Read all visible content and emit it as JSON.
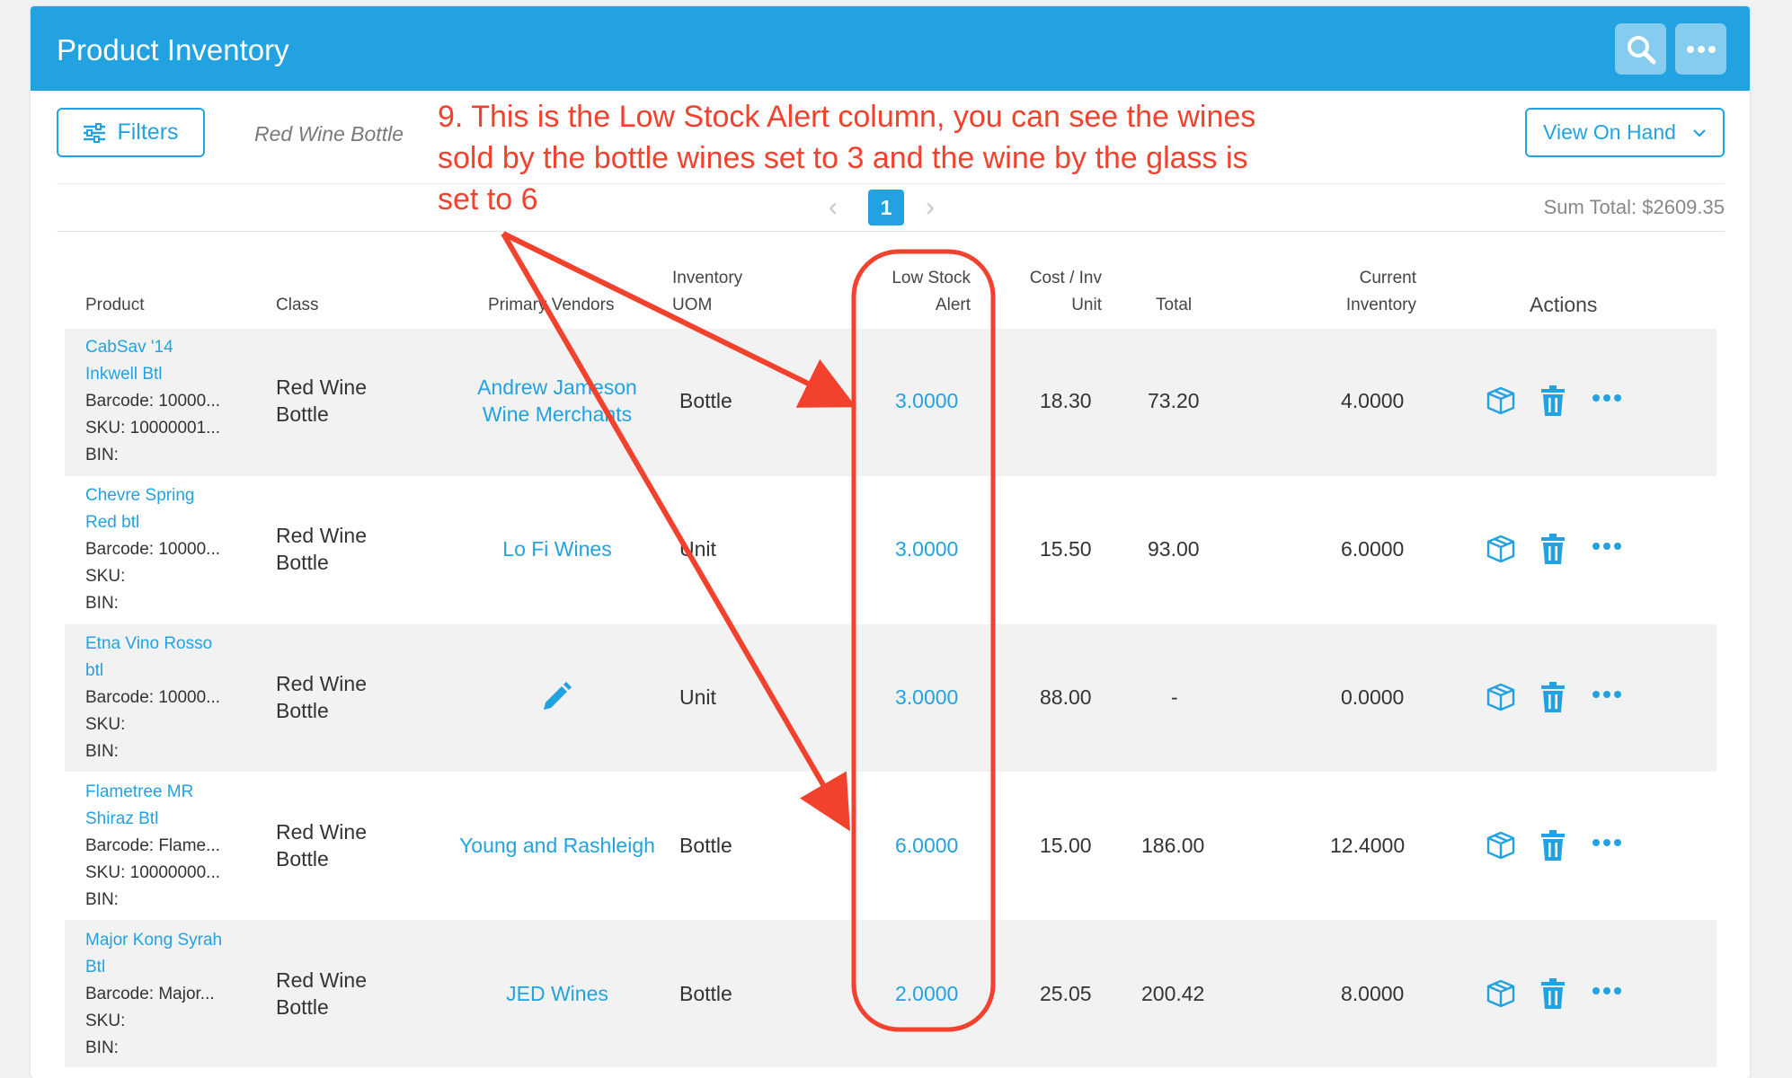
{
  "header": {
    "title": "Product Inventory"
  },
  "toolbar": {
    "filters_label": "Filters",
    "active_filter": "Red Wine Bottle",
    "view_label": "View On Hand"
  },
  "pagination": {
    "prev": "‹",
    "current": "1",
    "next": "›"
  },
  "sum_total": "Sum Total: $2609.35",
  "columns": {
    "product": "Product",
    "class": "Class",
    "vendors": "Primary Vendors",
    "uom_1": "Inventory",
    "uom_2": "UOM",
    "alert_1": "Low Stock",
    "alert_2": "Alert",
    "cost_1": "Cost / Inv",
    "cost_2": "Unit",
    "total": "Total",
    "current_1": "Current",
    "current_2": "Inventory",
    "actions": "Actions"
  },
  "rows": [
    {
      "name_1": "CabSav '14",
      "name_2": "Inkwell Btl",
      "barcode": "Barcode: 10000...",
      "sku": "SKU: 10000001...",
      "bin": "BIN:",
      "class_1": "Red Wine",
      "class_2": "Bottle",
      "vendor_1": "Andrew Jameson",
      "vendor_2": "Wine Merchants",
      "uom": "Bottle",
      "alert": "3.0000",
      "cost": "18.30",
      "total": "73.20",
      "current": "4.0000"
    },
    {
      "name_1": "Chevre Spring",
      "name_2": "Red btl",
      "barcode": "Barcode: 10000...",
      "sku": "SKU:",
      "bin": "BIN:",
      "class_1": "Red Wine",
      "class_2": "Bottle",
      "vendor_1": "Lo Fi Wines",
      "vendor_2": "",
      "uom": "Unit",
      "alert": "3.0000",
      "cost": "15.50",
      "total": "93.00",
      "current": "6.0000"
    },
    {
      "name_1": "Etna Vino Rosso",
      "name_2": "btl",
      "barcode": "Barcode: 10000...",
      "sku": "SKU:",
      "bin": "BIN:",
      "class_1": "Red Wine",
      "class_2": "Bottle",
      "vendor_1": "",
      "vendor_2": "",
      "uom": "Unit",
      "alert": "3.0000",
      "cost": "88.00",
      "total": "-",
      "current": "0.0000"
    },
    {
      "name_1": "Flametree MR",
      "name_2": "Shiraz Btl",
      "barcode": "Barcode: Flame...",
      "sku": "SKU: 10000000...",
      "bin": "BIN:",
      "class_1": "Red Wine",
      "class_2": "Bottle",
      "vendor_1": "Young and Rashleigh",
      "vendor_2": "",
      "uom": "Bottle",
      "alert": "6.0000",
      "cost": "15.00",
      "total": "186.00",
      "current": "12.4000"
    },
    {
      "name_1": "Major Kong Syrah",
      "name_2": "Btl",
      "barcode": "Barcode: Major...",
      "sku": "SKU:",
      "bin": "BIN:",
      "class_1": "Red Wine",
      "class_2": "Bottle",
      "vendor_1": "JED Wines",
      "vendor_2": "",
      "uom": "Bottle",
      "alert": "2.0000",
      "cost": "25.05",
      "total": "200.42",
      "current": "8.0000"
    }
  ],
  "annotation": {
    "line_1": "9. This is the Low Stock Alert column, you can see the wines",
    "line_2": "sold by the bottle wines set to 3 and the wine by the glass is",
    "line_3": "set to 6",
    "color": "#f2412d"
  },
  "colors": {
    "accent": "#22a2e0",
    "annotation": "#f2412d"
  },
  "icons": {
    "header": [
      "search-icon",
      "more-icon"
    ],
    "filters": "sliders-icon",
    "view": "chevron-down-icon",
    "row_actions": [
      "box-icon",
      "trash-icon",
      "more-icon"
    ],
    "missing_vendor": "pencil-icon"
  }
}
